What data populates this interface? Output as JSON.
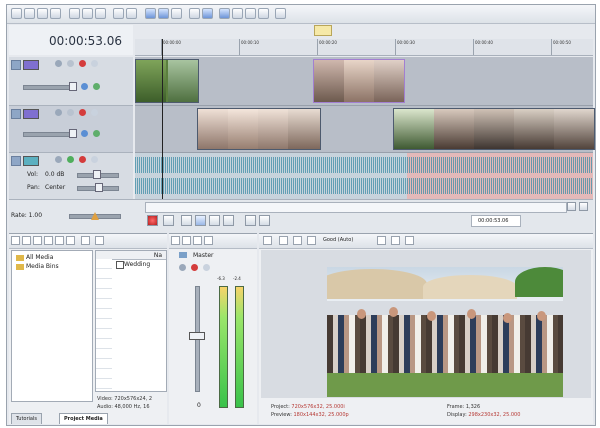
{
  "timeline": {
    "timecode": "00:00:53.06",
    "marker_label": "",
    "ruler_labels": [
      "00:00:00",
      "00:00:10",
      "00:00:20",
      "00:00:30",
      "00:00:40",
      "00:00:50",
      "00:01:00"
    ],
    "end_timecode": "00:00:53.06"
  },
  "audio_track": {
    "vol_label": "Vol:",
    "vol_value": "0.0 dB",
    "pan_label": "Pan:",
    "pan_value": "Center"
  },
  "transport": {
    "rate_label": "Rate: 1.00"
  },
  "media_pane": {
    "tree_items": [
      "All Media",
      "Media Bins"
    ],
    "list_header": "Na",
    "list_item": "Wedding",
    "video_info": "Video: 720x576x24, 2",
    "audio_info": "Audio: 48,000 Hz, 16",
    "tabs": [
      "Tutorials",
      "Project Media"
    ]
  },
  "mixer": {
    "title": "Master",
    "meter_labels": [
      "-6.3",
      "-2.4"
    ],
    "bottom_value": "0"
  },
  "preview_pane": {
    "quality": "Good (Auto)",
    "project_label": "Project:",
    "project_value": "720x576x32, 25.000i",
    "preview_label": "Preview:",
    "preview_value": "180x144x32, 25.000p",
    "frame_label": "Frame:",
    "frame_value": "1,326",
    "display_label": "Display:",
    "display_value": "298x230x32, 25.000"
  },
  "colors": {
    "audio_wave": "#3f8ea6",
    "audio_region": "#e4b9b9",
    "video_selection": "#a27fd1",
    "record_button": "#c62c2c"
  }
}
